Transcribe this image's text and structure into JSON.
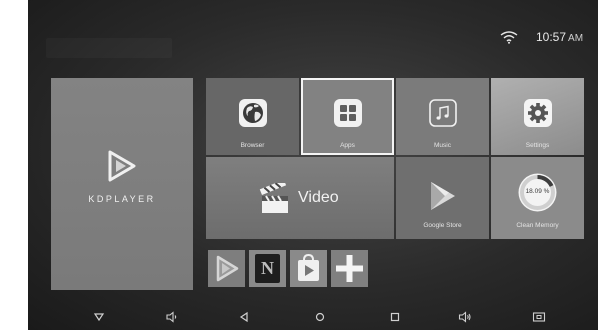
{
  "status_bar": {
    "time": "10:57",
    "ampm": "AM",
    "wifi_icon": "wifi-icon"
  },
  "launcher": {
    "logo_text": "KDPLAYER",
    "tiles": {
      "browser": "Browser",
      "apps": "Apps",
      "music": "Music",
      "settings": "Settings",
      "video": "Video",
      "google_store": "Google Store",
      "clean_memory": "Clean Memory",
      "memory_percent": "18.09 %"
    },
    "memory_used_fraction": 0.1809,
    "shortcuts": [
      "kdplayer-shortcut",
      "netflix-shortcut",
      "play-store-shortcut",
      "add-shortcut"
    ],
    "netflix_letter": "N"
  },
  "navbar": {
    "icons": [
      "menu-down-icon",
      "volume-down-icon",
      "back-icon",
      "home-icon",
      "recents-icon",
      "volume-up-icon",
      "screenshot-icon"
    ]
  },
  "colors": {
    "selection": "#f4f4f4",
    "background": "#2e2e2e",
    "tile_text": "#e4e4e4"
  }
}
